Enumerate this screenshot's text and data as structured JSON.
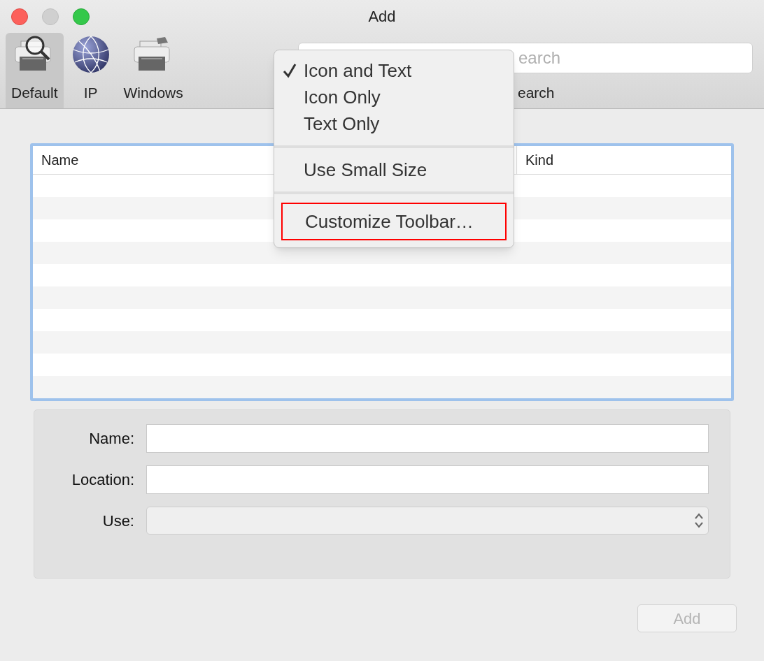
{
  "window": {
    "title": "Add"
  },
  "toolbar": {
    "items": [
      {
        "label": "Default",
        "kind": "magnifier-printer",
        "selected": true
      },
      {
        "label": "IP",
        "kind": "globe",
        "selected": false
      },
      {
        "label": "Windows",
        "kind": "printer",
        "selected": false
      }
    ],
    "search": {
      "placeholder": "earch",
      "label": "earch"
    }
  },
  "context_menu": {
    "items": [
      {
        "kind": "item",
        "label": "Icon and Text",
        "checked": true,
        "highlighted": false
      },
      {
        "kind": "item",
        "label": "Icon Only",
        "checked": false,
        "highlighted": false
      },
      {
        "kind": "item",
        "label": "Text Only",
        "checked": false,
        "highlighted": false
      },
      {
        "kind": "separator"
      },
      {
        "kind": "item",
        "label": "Use Small Size",
        "checked": false,
        "highlighted": false
      },
      {
        "kind": "separator"
      },
      {
        "kind": "item",
        "label": "Customize Toolbar…",
        "checked": false,
        "highlighted": true
      }
    ]
  },
  "table": {
    "columns": [
      "Name",
      "Kind"
    ]
  },
  "form": {
    "fields": [
      {
        "label": "Name:",
        "kind": "text"
      },
      {
        "label": "Location:",
        "kind": "text"
      },
      {
        "label": "Use:",
        "kind": "popup"
      }
    ]
  },
  "add_button": {
    "label": "Add",
    "disabled": true
  }
}
